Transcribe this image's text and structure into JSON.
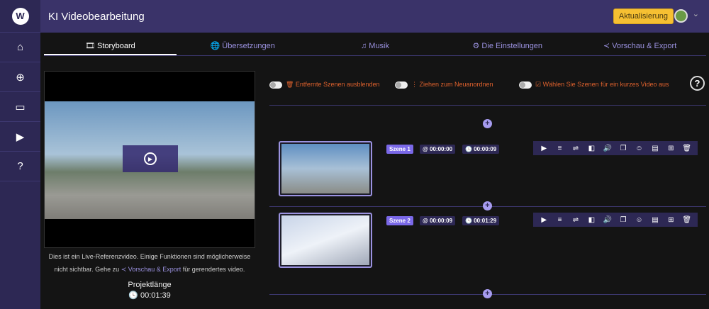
{
  "app": {
    "title": "KI Videobearbeitung",
    "update_label": "Aktualisierung",
    "logo": "W"
  },
  "sidebar": {
    "items": [
      {
        "icon": "home-icon",
        "glyph": "⌂"
      },
      {
        "icon": "add-icon",
        "glyph": "⊕"
      },
      {
        "icon": "folder-icon",
        "glyph": "▭"
      },
      {
        "icon": "video-library-icon",
        "glyph": "▶"
      },
      {
        "icon": "help-icon",
        "glyph": "?"
      }
    ]
  },
  "tabs": [
    {
      "label": "🎞 Storyboard",
      "active": true
    },
    {
      "label": "🌐 Übersetzungen"
    },
    {
      "label": "♫ Musik"
    },
    {
      "label": "⚙ Die Einstellungen"
    },
    {
      "label": "≺ Vorschau & Export"
    }
  ],
  "toggles": [
    {
      "label": "🗑 Entfernte Szenen ausblenden"
    },
    {
      "label": "⋮ Ziehen zum Neuanordnen"
    },
    {
      "label": "☑ Wählen Sie Szenen für ein kurzes Video aus"
    }
  ],
  "player": {
    "note_pre": "Dies ist ein Live-Referenzvideo. Einige Funktionen sind möglicherweise nicht sichtbar. Gehe zu ",
    "note_link": "≺ Vorschau & Export",
    "note_post": " für gerendertes video.",
    "length_label": "Projektlänge",
    "length_value": "🕓 00:01:39"
  },
  "scenes": [
    {
      "name": "Szene 1",
      "start": "@ 00:00:00",
      "duration": "🕓 00:00:09"
    },
    {
      "name": "Szene 2",
      "start": "@ 00:00:09",
      "duration": "🕓 00:01:29"
    }
  ],
  "scene_tools": [
    "play-icon",
    "playlist-icon",
    "transition-icon",
    "flip-icon",
    "volume-icon",
    "copy-icon",
    "emoji-icon",
    "subtitle-icon",
    "add-scene-icon",
    "delete-icon"
  ],
  "colors": {
    "accent": "#9b92e0",
    "header": "#3a3369",
    "sidebar": "#2d2854",
    "warning": "#e0622d",
    "update": "#f6c032"
  }
}
